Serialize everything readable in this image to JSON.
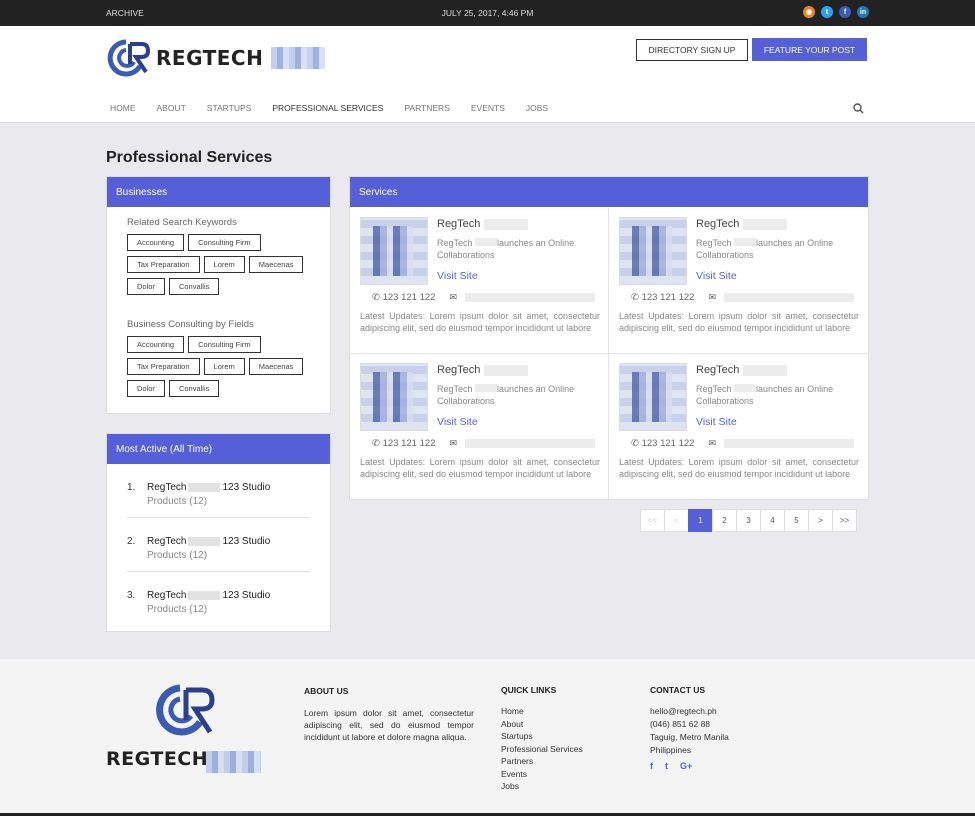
{
  "topbar": {
    "archive": "ARCHIVE",
    "date": "JULY 25, 2017, 4:46 PM",
    "socials": [
      "rss-icon",
      "twitter-icon",
      "facebook-icon",
      "linkedin-icon"
    ]
  },
  "header": {
    "brand": "REGTECH",
    "directory_btn": "DIRECTORY SIGN UP",
    "feature_btn": "FEATURE YOUR POST",
    "nav": [
      "HOME",
      "ABOUT",
      "STARTUPS",
      "PROFESSIONAL SERVICES",
      "PARTNERS",
      "EVENTS",
      "JOBS"
    ],
    "active_nav": "PROFESSIONAL SERVICES"
  },
  "page": {
    "title": "Professional Services"
  },
  "businesses": {
    "heading": "Businesses",
    "related_heading": "Related Search Keywords",
    "related_tags": [
      "Accounting",
      "Consulting Firm",
      "Tax Preparation",
      "Lorem",
      "Maecenas",
      "Dolor",
      "Convallis"
    ],
    "fields_heading": "Business Consulting by Fields",
    "field_tags": [
      "Accounting",
      "Consulting Firm",
      "Tax Preparation",
      "Lorem",
      "Maecenas",
      "Dolor",
      "Convallis"
    ]
  },
  "most_active": {
    "heading": "Most Active (All Time)",
    "items": [
      {
        "num": "1.",
        "name_a": "RegTech",
        "name_b": "123 Studio",
        "sub": "Products (12)"
      },
      {
        "num": "2.",
        "name_a": "RegTech",
        "name_b": "123 Studio",
        "sub": "Products (12)"
      },
      {
        "num": "3.",
        "name_a": "RegTech",
        "name_b": "123 Studio",
        "sub": "Products (12)"
      }
    ]
  },
  "services": {
    "heading": "Services",
    "cards": [
      {
        "title": "RegTech",
        "desc_a": "RegTech",
        "desc_b": "launches an Online Collaborations",
        "link": "Visit Site",
        "phone": "123 121 122",
        "latest": "Latest Updates: Lorem ipsum dolor sit amet, consectetur adipiscing elit, sed do eiusmod tempor incididunt ut labore"
      },
      {
        "title": "RegTech",
        "desc_a": "RegTech",
        "desc_b": "launches an Online Collaborations",
        "link": "Visit Site",
        "phone": "123 121 122",
        "latest": "Latest Updates: Lorem ipsum dolor sit amet, consectetur adipiscing elit, sed do eiusmod tempor incididunt ut labore"
      },
      {
        "title": "RegTech",
        "desc_a": "RegTech",
        "desc_b": "launches an Online Collaborations",
        "link": "Visit Site",
        "phone": "123 121 122",
        "latest": "Latest Updates: Lorem ipsum dolor sit amet, consectetur adipiscing elit, sed do eiusmod tempor incididunt ut labore"
      },
      {
        "title": "RegTech",
        "desc_a": "RegTech",
        "desc_b": "launches an Online Collaborations",
        "link": "Visit Site",
        "phone": "123 121 122",
        "latest": "Latest Updates: Lorem ipsum dolor sit amet, consectetur adipiscing elit, sed do eiusmod tempor incididunt ut labore"
      }
    ]
  },
  "pagination": {
    "items": [
      "<<",
      "<",
      "1",
      "2",
      "3",
      "4",
      "5",
      ">",
      ">>"
    ],
    "current": "1"
  },
  "footer": {
    "brand": "REGTECH",
    "about_heading": "ABOUT US",
    "about_text": "Lorem ipsum dolor sit amet, consectetur adipiscing elit, sed do eiusmod tempor incididunt ut labore et dolore magna aliqua.",
    "links_heading": "QUICK LINKS",
    "links": [
      "Home",
      "About",
      "Startups",
      "Professional Services",
      "Partners",
      "Events",
      "Jobs"
    ],
    "contact_heading": "CONTACT US",
    "email": "hello@regtech.ph",
    "phone": "(046) 851 62 88",
    "address_1": "Taguig, Metro Manila",
    "address_2": "Philippines",
    "socials": [
      "facebook-icon",
      "twitter-icon",
      "google-plus-icon"
    ]
  },
  "colors": {
    "accent": "#5560d8",
    "topbar": "#222222"
  }
}
